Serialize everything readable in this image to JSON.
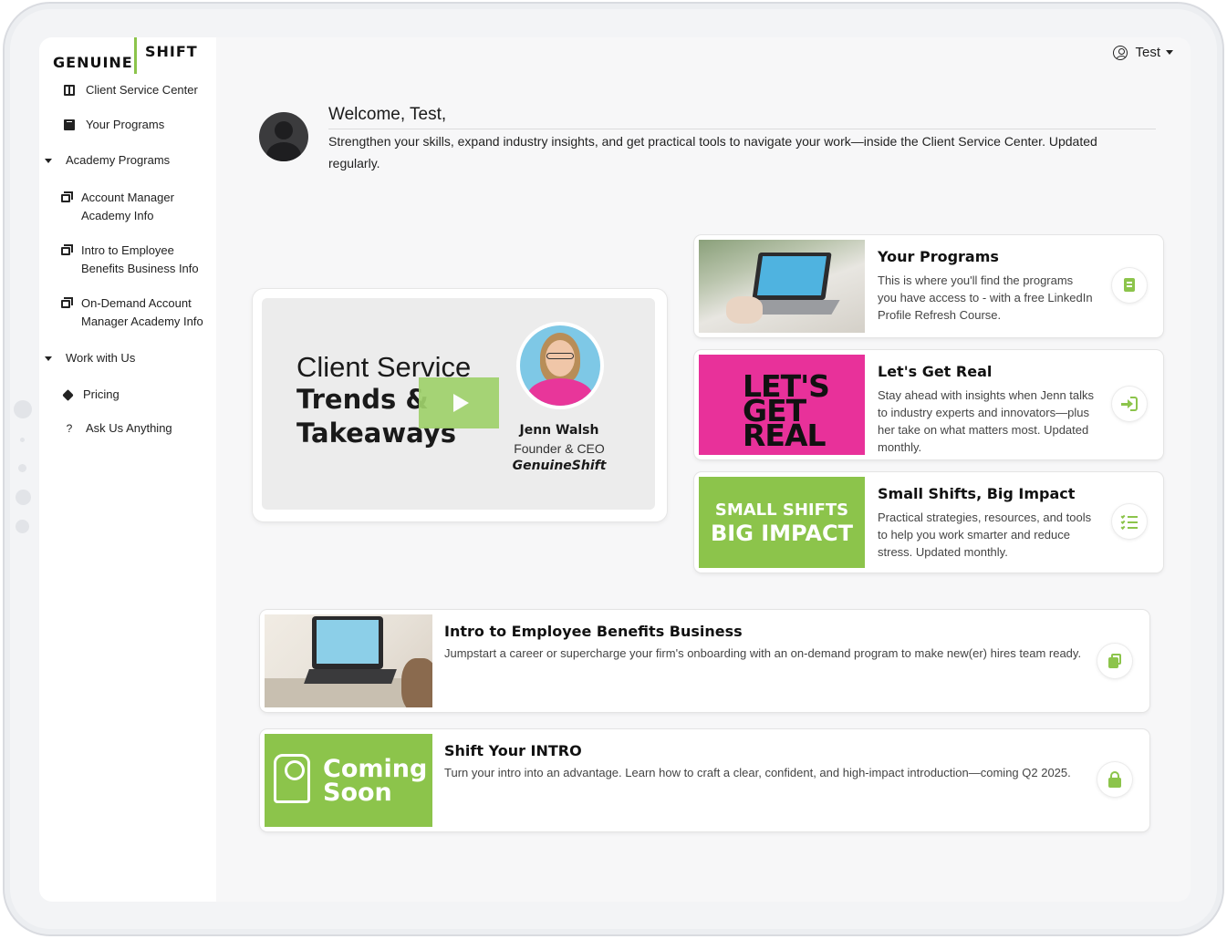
{
  "app": {
    "logo_left": "GENUINE",
    "logo_right": "SHIFT",
    "brand_green": "#8cc44b",
    "brand_pink": "#e8319a"
  },
  "user_menu": {
    "label": "Test"
  },
  "sidebar": {
    "items": [
      {
        "label": "Client Service Center",
        "icon": "columns-icon"
      },
      {
        "label": "Your Programs",
        "icon": "book-icon"
      },
      {
        "label": "Academy Programs",
        "icon": "caret-down-icon"
      },
      {
        "label": "Account Manager Academy Info",
        "icon": "copy-icon"
      },
      {
        "label": "Intro to Employee Benefits Business Info",
        "icon": "copy-icon"
      },
      {
        "label": "On-Demand Account Manager Academy Info",
        "icon": "copy-icon"
      },
      {
        "label": "Work with Us",
        "icon": "caret-down-icon"
      },
      {
        "label": "Pricing",
        "icon": "tag-icon"
      },
      {
        "label": "Ask Us Anything",
        "icon": "question-icon",
        "glyph": "?"
      }
    ]
  },
  "welcome": {
    "title": "Welcome, Test,",
    "text": "Strengthen your skills, expand industry insights, and get practical tools to navigate your work—inside the Client Service Center. Updated regularly."
  },
  "video": {
    "line1": "Client Service",
    "line2": "Trends &",
    "line3": "Takeaways",
    "name": "Jenn Walsh",
    "role": "Founder & CEO",
    "company": "GenuineShift"
  },
  "cards": [
    {
      "title": "Your Programs",
      "desc": "This is where you'll find the programs you have access to - with a free LinkedIn Profile Refresh Course.",
      "icon": "book-icon"
    },
    {
      "title": "Let's Get Real",
      "desc": "Stay ahead with insights when Jenn talks to industry experts and innovators—plus her take on what matters most. Updated monthly.",
      "image_text": [
        "LET'S",
        "GET",
        "REAL"
      ],
      "icon": "login-icon"
    },
    {
      "title": "Small Shifts, Big Impact",
      "desc": "Practical strategies, resources, and tools to help you work smarter and reduce stress. Updated monthly.",
      "image_text": [
        "SMALL SHIFTS",
        "BIG IMPACT"
      ],
      "icon": "list-check-icon"
    }
  ],
  "wide_cards": [
    {
      "title": "Intro to Employee Benefits Business",
      "desc": "Jumpstart a career or supercharge your firm's onboarding with an on-demand program to make new(er) hires team ready.",
      "icon": "copy-icon"
    },
    {
      "title": "Shift Your INTRO",
      "desc": "Turn your intro into an advantage. Learn how to craft a clear, confident, and high-impact introduction—coming Q2 2025.",
      "image_text": [
        "Coming",
        "Soon"
      ],
      "icon": "lock-icon"
    }
  ]
}
